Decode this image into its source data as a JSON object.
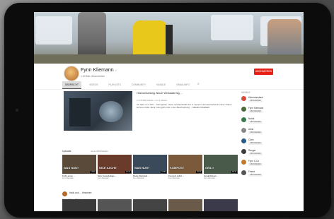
{
  "channel": {
    "name": "Fynn Kliemann",
    "verified_glyph": "✓",
    "subscribers": "1,00 Mio. Abonnenten",
    "subscribe_label": "ABONNIEREN"
  },
  "tabs": [
    {
      "label": "ÜBERSICHT"
    },
    {
      "label": "VIDEOS"
    },
    {
      "label": "PLAYLISTS"
    },
    {
      "label": "COMMUNITY"
    },
    {
      "label": "KANÄLE"
    },
    {
      "label": "KANALINFO"
    }
  ],
  "search_icon": "search-icon",
  "featured": {
    "title": "Heimwerkerking: Neuer Werkstatt-Tag ...",
    "meta": "2.279.530 Aufrufe • vor 3 Jahren",
    "description": "Ich habe so 2.279 ... Kleingarten, Haus und Werkstatt hier in meinem Heimwerkerkanal. Neue Videos kommen bald. Mehr Infos gibt's hier in der Beschreibung ... MEHR ANSEHEN"
  },
  "sidebar": {
    "heading": "KANÄLE",
    "items": [
      {
        "name": "Kliemannsland",
        "button": "ABONNIEREN",
        "color": "#d94c3c"
      },
      {
        "name": "Fynn Kliemann",
        "button": "ABONNIEREN",
        "color": "#4a6a3a"
      },
      {
        "name": "Nubia",
        "button": "ABONNIEREN",
        "color": "#3a7a4a"
      },
      {
        "name": "Artist",
        "button": "ABONNIEREN",
        "color": "#888888"
      },
      {
        "name": "Chris",
        "button": "ABONNIEREN",
        "color": "#2a5a8a"
      },
      {
        "name": "Ranger",
        "button": "ABONNIEREN",
        "color": "#3c3c3c"
      },
      {
        "name": "Fynn & Co",
        "button": "ABONNIEREN",
        "color": "#c27a2a"
      },
      {
        "name": "Friend",
        "button": "ABONNIEREN",
        "color": "#555555"
      }
    ]
  },
  "uploads": {
    "title": "Uploads",
    "play_all": "ALLE ABSPIELEN",
    "videos": [
      {
        "caption": "WAS NUN?",
        "duration": "13:02",
        "title": "Fluß Lampe ...",
        "meta": "Fynn Kliemann",
        "color": "#5a4a3a"
      },
      {
        "caption": "NICE SACHE",
        "duration": "12:41",
        "title": "Nicer Gewerkelage ...",
        "meta": "Fynn Kliemann",
        "color": "#6a3a2a"
      },
      {
        "caption": "WAS NUN?",
        "duration": "11:55",
        "title": "Meine Werkstatt ...",
        "meta": "Fynn Kliemann",
        "color": "#3a4a5a"
      },
      {
        "caption": "KOMPOST",
        "duration": "15:10",
        "title": "Kompost selbst ...",
        "meta": "Fynn Kliemann",
        "color": "#7a5a3a"
      },
      {
        "caption": "GEIL!!",
        "duration": "09:34",
        "title": "Gewächshaus ...",
        "meta": "Fynn Kliemann",
        "color": "#4a5a4a"
      }
    ]
  },
  "post": {
    "text": "Hallo und ... Hinsehen",
    "sub": "Neues Video ... Beitrag ..."
  },
  "row2": [
    {
      "color": "#3a3a3a"
    },
    {
      "color": "#555555"
    },
    {
      "color": "#444444"
    },
    {
      "color": "#6a5a4a"
    },
    {
      "color": "#3a3a4a"
    }
  ]
}
